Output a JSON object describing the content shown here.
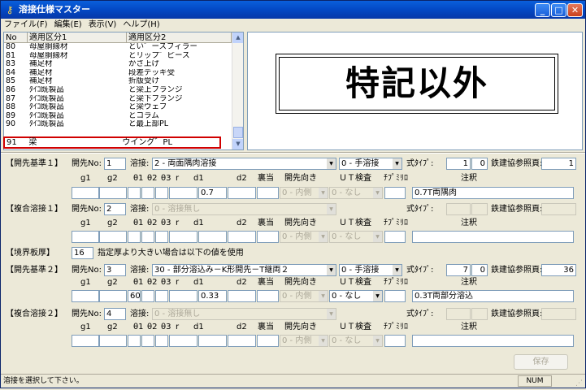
{
  "window": {
    "title": "溶接仕様マスター"
  },
  "menu": [
    "ファイル(F)",
    "編集(E)",
    "表示(V)",
    "ヘルプ(H)"
  ],
  "list": {
    "headers": [
      "No",
      "適用区分1",
      "適用区分2"
    ],
    "rows": [
      [
        "80",
        "母屋胴縁材",
        "とい゛ースフィラー"
      ],
      [
        "81",
        "母屋胴縁材",
        "とリップ゛ピース"
      ],
      [
        "83",
        "補足材",
        "かさ上げ"
      ],
      [
        "84",
        "補足材",
        "段差デッキ受"
      ],
      [
        "85",
        "補足材",
        "折版受け"
      ],
      [
        "86",
        "ﾀｲｺ既製品",
        "と梁上フランジ"
      ],
      [
        "87",
        "ﾀｲｺ既製品",
        "と梁下フランジ"
      ],
      [
        "88",
        "ﾀｲｺ既製品",
        "と梁ウェブ"
      ],
      [
        "89",
        "ﾀｲｺ既製品",
        "とコラム"
      ],
      [
        "90",
        "ﾀｲｺ既製品",
        "と最上部PL"
      ]
    ],
    "selected": [
      "91",
      "梁",
      "ウイング゛PL"
    ]
  },
  "preview": {
    "text": "特記以外"
  },
  "groove1": {
    "label": "【開先基準１】",
    "no_label": "開先No:",
    "no": "1",
    "weld_label": "溶接:",
    "weld": "2 - 両面隅肉溶接",
    "type": "0 - 手溶接",
    "shiki_label": "式ﾀｲﾌﾟ:",
    "shiki": "1",
    "shiki2": "0",
    "ref_label": "鉄建協参照頁:",
    "ref": "1",
    "d1": "0.7",
    "dir": "0 - 内側",
    "chk": "0 - なし",
    "note": "0.7T両隅肉"
  },
  "multi1": {
    "label": "【複合溶接１】",
    "no_label": "開先No:",
    "no": "2",
    "weld_label": "溶接:",
    "weld": "0 - 溶接無し",
    "shiki_label": "式ﾀｲﾌﾟ:",
    "ref_label": "鉄建協参照頁:",
    "dir": "0 - 内側",
    "chk": "0 - なし"
  },
  "boundary": {
    "label": "【境界板厚】",
    "value": "16",
    "text": "指定厚より大きい場合は以下の値を使用"
  },
  "groove2": {
    "label": "【開先基準２】",
    "no_label": "開先No:",
    "no": "3",
    "weld_label": "溶接:",
    "weld": "30 - 部分溶込み－K形開先－T継両２",
    "type": "0 - 手溶接",
    "shiki_label": "式ﾀｲﾌﾟ:",
    "shiki": "7",
    "shiki2": "0",
    "ref_label": "鉄建協参照頁:",
    "ref": "36",
    "t1": "60",
    "d1": "0.33",
    "dir": "0 - 内側",
    "chk": "0 - なし",
    "note": "0.3T両部分溶込"
  },
  "multi2": {
    "label": "【複合溶接２】",
    "no_label": "開先No:",
    "no": "4",
    "weld_label": "溶接:",
    "weld": "0 - 溶接無し",
    "shiki_label": "式ﾀｲﾌﾟ:",
    "ref_label": "鉄建協参照頁:",
    "dir": "0 - 内側",
    "chk": "0 - なし"
  },
  "cols": {
    "g1": "g1",
    "g2": "g2",
    "t1": "θ1",
    "t2": "θ2",
    "t3": "θ3",
    "r": "r",
    "d1": "d1",
    "d2": "d2",
    "ura": "裏当",
    "dir": "開先向き",
    "ut": "ＵＴ検査",
    "chip": "ﾁﾌﾟﾐﾘﾛ",
    "note": "注釈"
  },
  "save_label": "保存",
  "status": {
    "text": "溶接を選択して下さい。",
    "num": "NUM"
  }
}
